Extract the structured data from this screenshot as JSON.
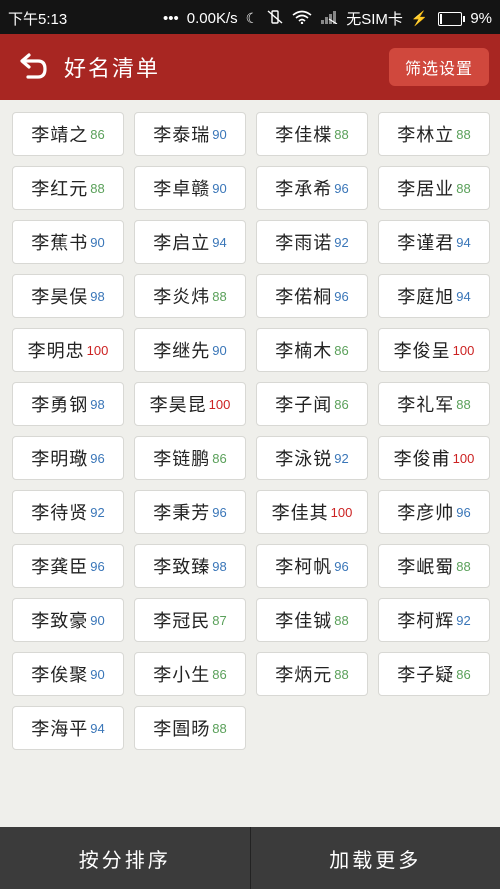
{
  "statusbar": {
    "time": "下午5:13",
    "dots": "•••",
    "speed": "0.00K/s",
    "sim": "无SIM卡",
    "battery": "9%",
    "battery_level": 0.09
  },
  "header": {
    "title": "好名清单",
    "filter_label": "筛选设置"
  },
  "colors": {
    "high": "#cc2222",
    "blue": "#3a76b8",
    "green": "#5aa05a"
  },
  "names": [
    {
      "name": "李靖之",
      "score": "86",
      "color": "green"
    },
    {
      "name": "李泰瑞",
      "score": "90",
      "color": "blue"
    },
    {
      "name": "李佳楪",
      "score": "88",
      "color": "green"
    },
    {
      "name": "李林立",
      "score": "88",
      "color": "green"
    },
    {
      "name": "李红元",
      "score": "88",
      "color": "green"
    },
    {
      "name": "李卓赣",
      "score": "90",
      "color": "blue"
    },
    {
      "name": "李承希",
      "score": "96",
      "color": "blue"
    },
    {
      "name": "李居业",
      "score": "88",
      "color": "green"
    },
    {
      "name": "李蕉书",
      "score": "90",
      "color": "blue"
    },
    {
      "name": "李启立",
      "score": "94",
      "color": "blue"
    },
    {
      "name": "李雨诺",
      "score": "92",
      "color": "blue"
    },
    {
      "name": "李谨君",
      "score": "94",
      "color": "blue"
    },
    {
      "name": "李昊俣",
      "score": "98",
      "color": "blue"
    },
    {
      "name": "李炎炜",
      "score": "88",
      "color": "green"
    },
    {
      "name": "李偌桐",
      "score": "96",
      "color": "blue"
    },
    {
      "name": "李庭旭",
      "score": "94",
      "color": "blue"
    },
    {
      "name": "李明忠",
      "score": "100",
      "color": "high"
    },
    {
      "name": "李继先",
      "score": "90",
      "color": "blue"
    },
    {
      "name": "李楠木",
      "score": "86",
      "color": "green"
    },
    {
      "name": "李俊呈",
      "score": "100",
      "color": "high"
    },
    {
      "name": "李勇钢",
      "score": "98",
      "color": "blue"
    },
    {
      "name": "李昊昆",
      "score": "100",
      "color": "high"
    },
    {
      "name": "李子闻",
      "score": "86",
      "color": "green"
    },
    {
      "name": "李礼军",
      "score": "88",
      "color": "green"
    },
    {
      "name": "李明璥",
      "score": "96",
      "color": "blue"
    },
    {
      "name": "李链鹏",
      "score": "86",
      "color": "green"
    },
    {
      "name": "李泳锐",
      "score": "92",
      "color": "blue"
    },
    {
      "name": "李俊甫",
      "score": "100",
      "color": "high"
    },
    {
      "name": "李待贤",
      "score": "92",
      "color": "blue"
    },
    {
      "name": "李秉芳",
      "score": "96",
      "color": "blue"
    },
    {
      "name": "李佳其",
      "score": "100",
      "color": "high"
    },
    {
      "name": "李彦帅",
      "score": "96",
      "color": "blue"
    },
    {
      "name": "李龚臣",
      "score": "96",
      "color": "blue"
    },
    {
      "name": "李致臻",
      "score": "98",
      "color": "blue"
    },
    {
      "name": "李柯帆",
      "score": "96",
      "color": "blue"
    },
    {
      "name": "李岷蜀",
      "score": "88",
      "color": "green"
    },
    {
      "name": "李致豪",
      "score": "90",
      "color": "blue"
    },
    {
      "name": "李冠民",
      "score": "87",
      "color": "green"
    },
    {
      "name": "李佳铖",
      "score": "88",
      "color": "green"
    },
    {
      "name": "李柯辉",
      "score": "92",
      "color": "blue"
    },
    {
      "name": "李俟聚",
      "score": "90",
      "color": "blue"
    },
    {
      "name": "李小生",
      "score": "86",
      "color": "green"
    },
    {
      "name": "李炳元",
      "score": "88",
      "color": "green"
    },
    {
      "name": "李子疑",
      "score": "86",
      "color": "green"
    },
    {
      "name": "李海平",
      "score": "94",
      "color": "blue"
    },
    {
      "name": "李圄旸",
      "score": "88",
      "color": "green"
    }
  ],
  "bottom": {
    "sort_label": "按分排序",
    "more_label": "加载更多"
  }
}
